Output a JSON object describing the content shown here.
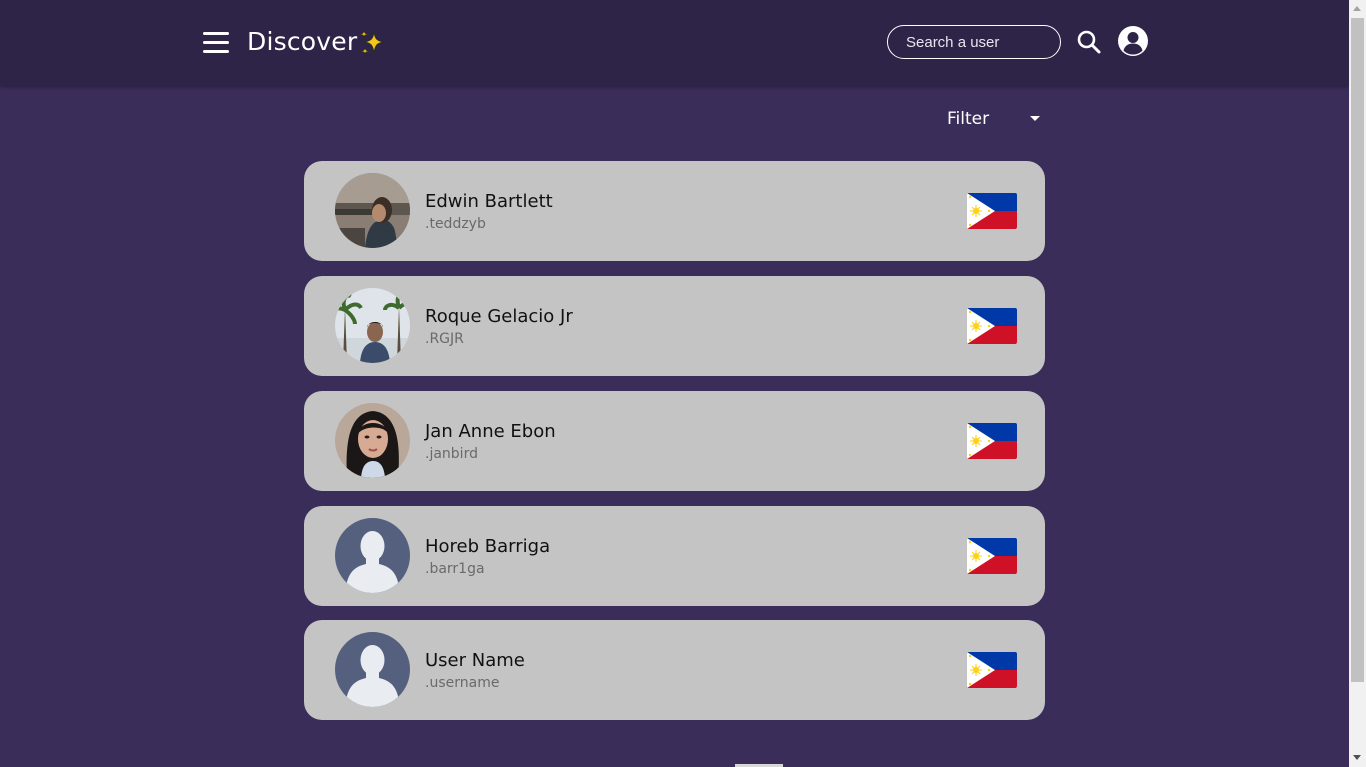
{
  "header": {
    "title": "Discover",
    "search_placeholder": "Search a user",
    "icons": [
      "hamburger-menu-icon",
      "sparkles-icon",
      "search-icon",
      "account-icon"
    ]
  },
  "filter": {
    "label": "Filter"
  },
  "users": [
    {
      "name": "Edwin Bartlett",
      "handle": ".teddzyb",
      "avatar": "photo",
      "flag": "philippines-flag-icon"
    },
    {
      "name": "Roque Gelacio Jr",
      "handle": ".RGJR",
      "avatar": "photo",
      "flag": "philippines-flag-icon"
    },
    {
      "name": "Jan Anne Ebon",
      "handle": ".janbird",
      "avatar": "photo",
      "flag": "philippines-flag-icon"
    },
    {
      "name": "Horeb Barriga",
      "handle": ".barr1ga",
      "avatar": "default-avatar-icon",
      "flag": "philippines-flag-icon"
    },
    {
      "name": "User Name",
      "handle": ".username",
      "avatar": "default-avatar-icon",
      "flag": "philippines-flag-icon"
    }
  ],
  "colors": {
    "page_background": "#3b2d5a",
    "header_background": "#2d2447",
    "card_background": "#c4c4c4",
    "flag_blue": "#0038a8",
    "flag_red": "#ce1126",
    "flag_sun": "#fcd116"
  }
}
